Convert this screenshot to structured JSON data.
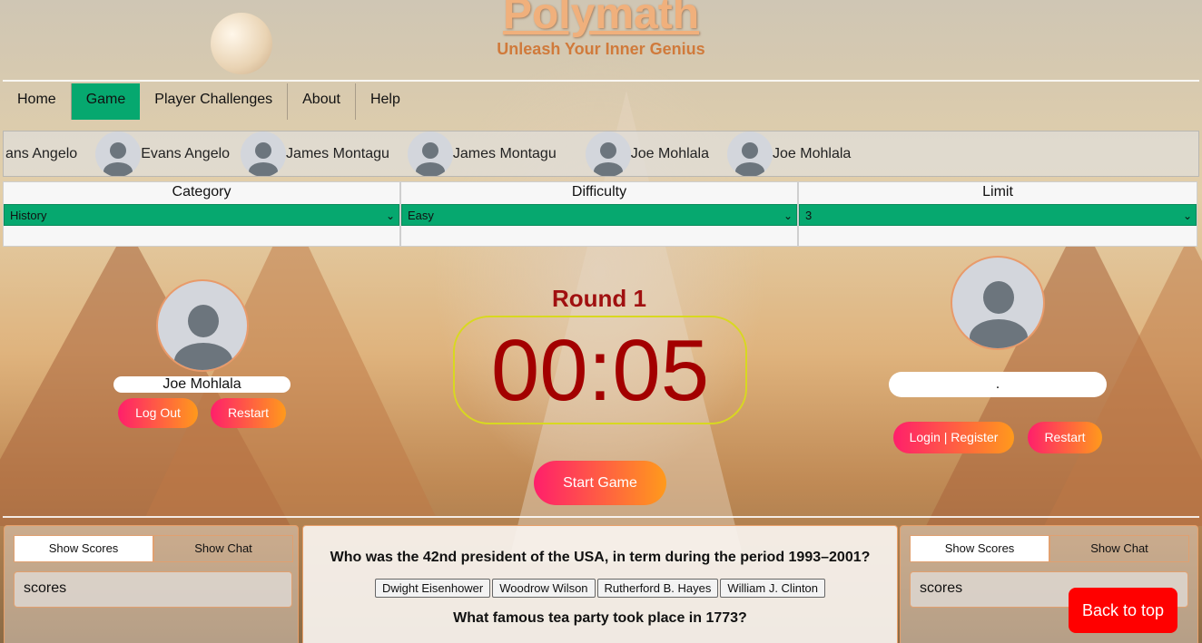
{
  "header": {
    "title": "Polymath",
    "subtitle": "Unleash Your Inner Genius"
  },
  "nav": {
    "items": [
      {
        "label": "Home",
        "active": false
      },
      {
        "label": "Game",
        "active": true
      },
      {
        "label": "Player Challenges",
        "active": false
      },
      {
        "label": "About",
        "active": false
      },
      {
        "label": "Help",
        "active": false
      }
    ]
  },
  "players_ticker": {
    "entries": [
      "ans Angelo",
      "Evans Angelo",
      "James Montagu",
      "James Montagu",
      "Joe Mohlala",
      "Joe Mohlala"
    ]
  },
  "settings": {
    "category": {
      "label": "Category",
      "value": "History"
    },
    "difficulty": {
      "label": "Difficulty",
      "value": "Easy"
    },
    "limit": {
      "label": "Limit",
      "value": "3"
    }
  },
  "player1": {
    "name": "Joe Mohlala",
    "logout_label": "Log Out",
    "restart_label": "Restart"
  },
  "player2": {
    "name": ".",
    "login_label": "Login | Register",
    "restart_label": "Restart"
  },
  "game": {
    "round_label": "Round 1",
    "timer": "00:05",
    "start_label": "Start Game"
  },
  "left_panel": {
    "show_scores": "Show Scores",
    "show_chat": "Show Chat",
    "scores_text": "scores"
  },
  "right_panel": {
    "show_scores": "Show Scores",
    "show_chat": "Show Chat",
    "scores_text": "scores"
  },
  "questions": [
    {
      "text": "Who was the 42nd president of the USA, in term during the period 1993–2001?",
      "answers": [
        "Dwight Eisenhower",
        "Woodrow Wilson",
        "Rutherford B. Hayes",
        "William J. Clinton"
      ]
    },
    {
      "text": "What famous tea party took place in 1773?"
    }
  ],
  "back_to_top": "Back to top",
  "colors": {
    "accent_green": "#06a86f",
    "title_orange": "#f0b07c",
    "timer_red": "#a30000",
    "button_gradient_start": "#ff1f6b",
    "button_gradient_end": "#ff9a1c",
    "back_to_top_red": "#ff0000"
  }
}
